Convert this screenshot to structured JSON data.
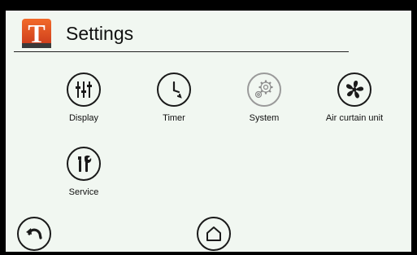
{
  "header": {
    "logo_letter": "T",
    "title": "Settings"
  },
  "menu": {
    "items": [
      {
        "label": "Display",
        "icon": "sliders-icon"
      },
      {
        "label": "Timer",
        "icon": "clock-icon"
      },
      {
        "label": "System",
        "icon": "gears-icon"
      },
      {
        "label": "Air curtain unit",
        "icon": "fan-icon"
      },
      {
        "label": "Service",
        "icon": "wrench-icon"
      }
    ]
  },
  "footer": {
    "back_icon": "back-arrow-icon",
    "home_icon": "home-icon"
  },
  "colors": {
    "background": "#f1f7f1",
    "logo_orange": "#e8501c",
    "icon_dark": "#1a1a1a",
    "icon_disabled": "#9a9a9a"
  }
}
